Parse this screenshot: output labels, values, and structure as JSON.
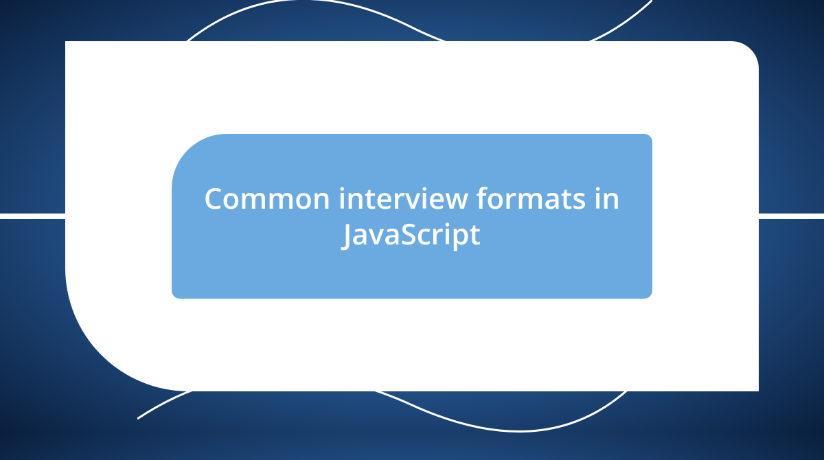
{
  "card": {
    "title": "Common interview formats in JavaScript"
  },
  "colors": {
    "background_dark": "#0a1f3d",
    "background_mid": "#2a5f9e",
    "background_light": "#5a9bd8",
    "inner_panel": "#6aaae0",
    "outer_panel": "#ffffff",
    "text": "#ffffff"
  }
}
